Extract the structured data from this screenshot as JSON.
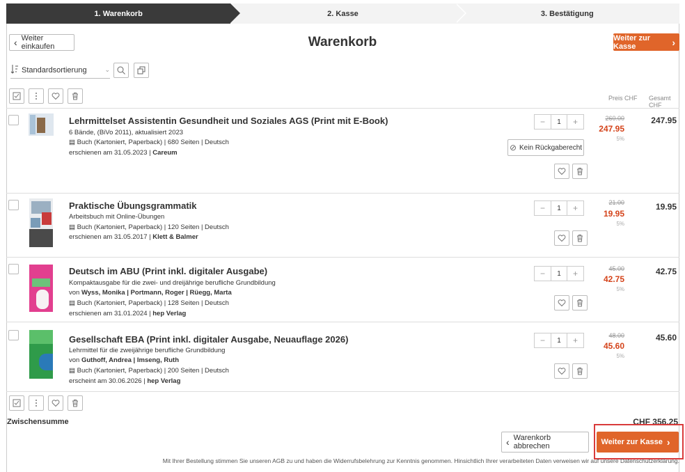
{
  "steps": [
    "1. Warenkorb",
    "2. Kasse",
    "3. Bestätigung"
  ],
  "header": {
    "back_label": "Weiter einkaufen",
    "title": "Warenkorb",
    "checkout_label": "Weiter zur Kasse"
  },
  "sort": {
    "selected": "Standardsortierung"
  },
  "columns": {
    "price": "Preis CHF",
    "total": "Gesamt CHF"
  },
  "items": [
    {
      "title": "Lehrmittelset Assistentin Gesundheit und Soziales AGS (Print mit E-Book)",
      "subtitle": "6 Bände, (BiVo 2011), aktualisiert 2023",
      "format": "Buch (Kartoniert, Paperback) | 680 Seiten | Deutsch",
      "release_prefix": "erschienen am 31.05.2023 | ",
      "publisher": "Careum",
      "qty": "1",
      "old_price": "260.00",
      "price": "247.95",
      "discount": "5%",
      "total": "247.95",
      "no_return": "Kein Rückgaberecht"
    },
    {
      "title": "Praktische Übungsgrammatik",
      "subtitle": "Arbeitsbuch mit Online-Übungen",
      "format": "Buch (Kartoniert, Paperback) | 120 Seiten | Deutsch",
      "release_prefix": "erschienen am 31.05.2017 | ",
      "publisher": "Klett & Balmer",
      "qty": "1",
      "old_price": "21.00",
      "price": "19.95",
      "discount": "5%",
      "total": "19.95"
    },
    {
      "title": "Deutsch im ABU (Print inkl. digitaler Ausgabe)",
      "subtitle": "Kompaktausgabe für die zwei- und dreijährige berufliche Grundbildung",
      "authors_prefix": "von ",
      "authors": "Wyss, Monika | Portmann, Roger | Rüegg, Marta",
      "format": "Buch (Kartoniert, Paperback) | 128 Seiten | Deutsch",
      "release_prefix": "erschienen am 31.01.2024 | ",
      "publisher": "hep Verlag",
      "qty": "1",
      "old_price": "45.00",
      "price": "42.75",
      "discount": "5%",
      "total": "42.75"
    },
    {
      "title": "Gesellschaft EBA (Print inkl. digitaler Ausgabe, Neuauflage 2026)",
      "subtitle": "Lehrmittel für die zweijährige berufliche Grundbildung",
      "authors_prefix": "von ",
      "authors": "Guthoff, Andrea | Imseng, Ruth",
      "format": "Buch (Kartoniert, Paperback) | 200 Seiten | Deutsch",
      "release_prefix": "erscheint am 30.06.2026 | ",
      "publisher": "hep Verlag",
      "qty": "1",
      "old_price": "48.00",
      "price": "45.60",
      "discount": "5%",
      "total": "45.60"
    }
  ],
  "summary": {
    "subtotal_label": "Zwischensumme",
    "subtotal_value": "CHF 356.25",
    "cancel_label": "Warenkorb abbrechen",
    "checkout_label": "Weiter zur Kasse"
  },
  "footer": {
    "legal": "Mit Ihrer Bestellung stimmen Sie unseren AGB zu und haben die Widerrufsbelehrung zur Kenntnis genommen. Hinsichtlich Ihrer verarbeiteten Daten verweisen wir auf unsere Datenschutzerklärung."
  },
  "colors": {
    "accent": "#e0652a",
    "price_red": "#d4431a",
    "step_active": "#3a3a3a"
  }
}
